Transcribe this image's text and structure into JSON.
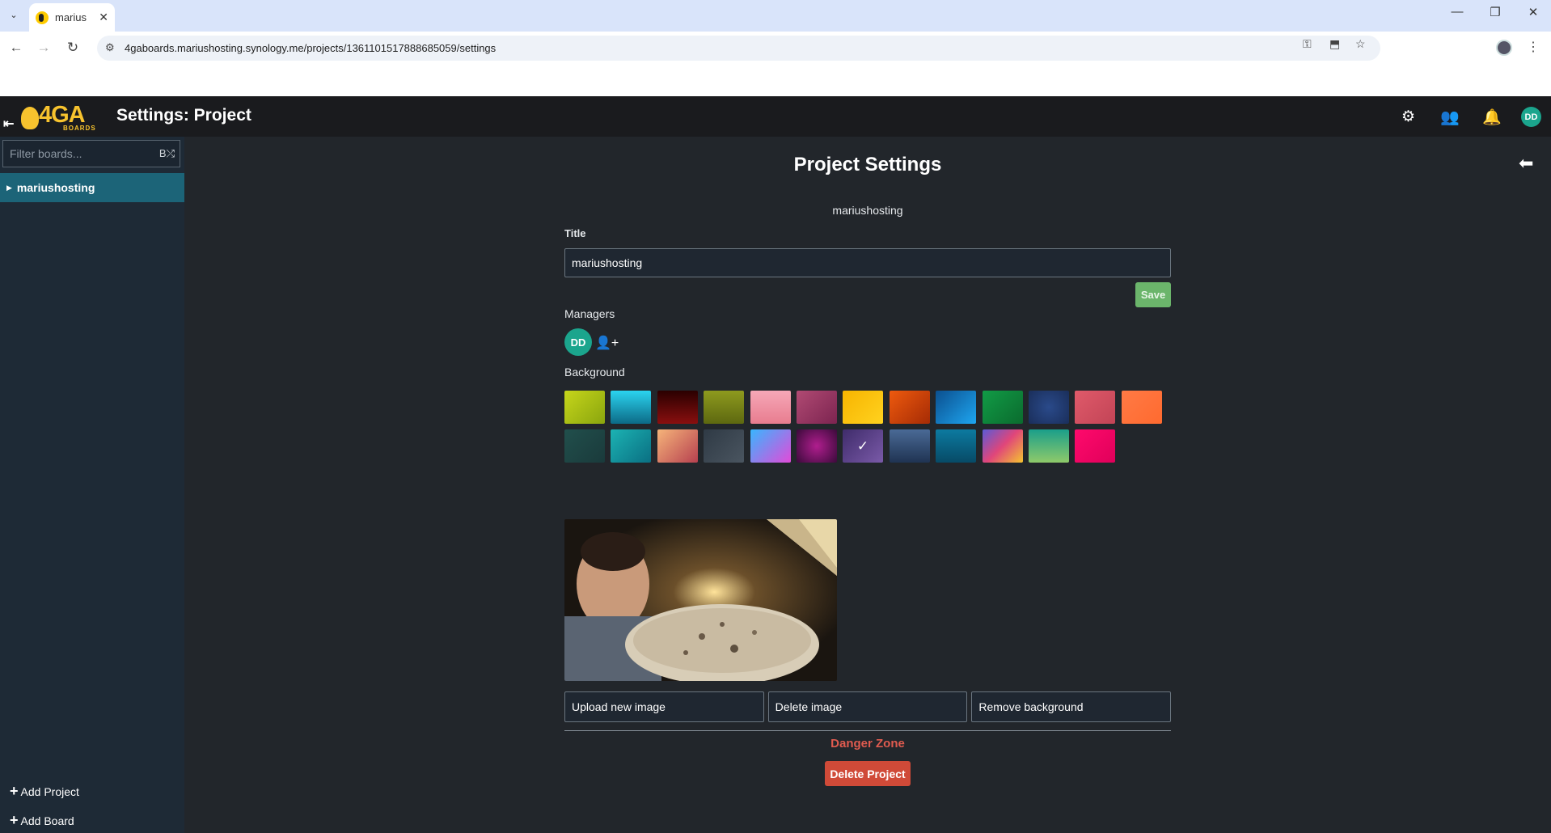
{
  "browser": {
    "tab_title": "marius",
    "tab_close": "✕",
    "url": "4gaboards.mariushosting.synology.me/projects/1361101517888685059/settings"
  },
  "header": {
    "logo_text": "4GA",
    "logo_sub": "BOARDS",
    "title": "Settings: Project",
    "avatar": "DD"
  },
  "sidebar": {
    "filter_placeholder": "Filter boards...",
    "project": "mariushosting",
    "add_project": "Add Project",
    "add_board": "Add Board"
  },
  "main": {
    "page_title": "Project Settings",
    "subtitle": "mariushosting",
    "title_label": "Title",
    "title_value": "mariushosting",
    "save_label": "Save",
    "managers_label": "Managers",
    "manager_avatar": "DD",
    "background_label": "Background",
    "selected_swatch_index": 19,
    "swatch_colors": [
      "linear-gradient(135deg,#c6d61b,#8aa50e)",
      "linear-gradient(180deg,#2bd4f0,#0c6a86)",
      "linear-gradient(180deg,#2a0000,#8a0f0f)",
      "linear-gradient(180deg,#8e9a1e,#5d6810)",
      "linear-gradient(180deg,#f6a8b8,#e87c8f)",
      "linear-gradient(135deg,#b04a73,#7c2450)",
      "linear-gradient(135deg,#f7b400,#ffd21f)",
      "linear-gradient(135deg,#ee5a0e,#a52b05)",
      "linear-gradient(135deg,#0b4f8f,#1ea6f0)",
      "linear-gradient(135deg,#119b46,#0b6b2e)",
      "radial-gradient(circle,#2a4a8a,#1a2e5a)",
      "linear-gradient(135deg,#e05a6a,#c24456)",
      "linear-gradient(135deg,#ff7a45,#ff6a2f)",
      "linear-gradient(135deg,#214f4c,#1a3a3b)",
      "linear-gradient(135deg,#1cb3b3,#0a6f82)",
      "linear-gradient(135deg,#f6b47a,#b6404f)",
      "linear-gradient(135deg,#2f3a45,#4a5560)",
      "linear-gradient(135deg,#38b6ff,#e24ad9)",
      "radial-gradient(circle,#b01e8e,#3a0a3a)",
      "linear-gradient(135deg,#3f2c6b,#7a5aa8)",
      "linear-gradient(180deg,#4a6a96,#1f3352)",
      "linear-gradient(180deg,#0c7aa0,#074a66)",
      "linear-gradient(135deg,#5a5ad6,#e0467a,#f5c42f)",
      "linear-gradient(180deg,#1a9e8a,#8fca6a)",
      "linear-gradient(135deg,#ff0a6c,#e0005a)"
    ],
    "upload_label": "Upload new image",
    "delete_image_label": "Delete image",
    "remove_bg_label": "Remove background",
    "danger_label": "Danger Zone",
    "delete_project_label": "Delete Project"
  }
}
